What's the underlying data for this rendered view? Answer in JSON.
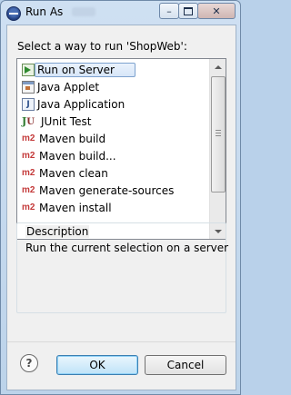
{
  "window": {
    "title": "Run As",
    "minimize_icon": "minimize-icon",
    "maximize_icon": "maximize-icon",
    "close_icon": "close-icon",
    "min_glyph": "–",
    "close_glyph": "✕"
  },
  "prompt": "Select a way to run 'ShopWeb':",
  "items": [
    {
      "label": "Run on Server",
      "icon": "server-run-icon",
      "selected": true
    },
    {
      "label": "Java Applet",
      "icon": "java-applet-icon"
    },
    {
      "label": "Java Application",
      "icon": "java-application-icon"
    },
    {
      "label": "JUnit Test",
      "icon": "junit-icon"
    },
    {
      "label": "Maven build",
      "icon": "maven-icon"
    },
    {
      "label": "Maven build...",
      "icon": "maven-icon"
    },
    {
      "label": "Maven clean",
      "icon": "maven-icon"
    },
    {
      "label": "Maven generate-sources",
      "icon": "maven-icon"
    },
    {
      "label": "Maven install",
      "icon": "maven-icon"
    }
  ],
  "icon_text": {
    "java_app": "J",
    "junit_j": "J",
    "junit_u": "U",
    "maven": "m2"
  },
  "description": {
    "title": "Description",
    "text": "Run the current selection on a server"
  },
  "buttons": {
    "help": "?",
    "ok": "OK",
    "cancel": "Cancel"
  }
}
